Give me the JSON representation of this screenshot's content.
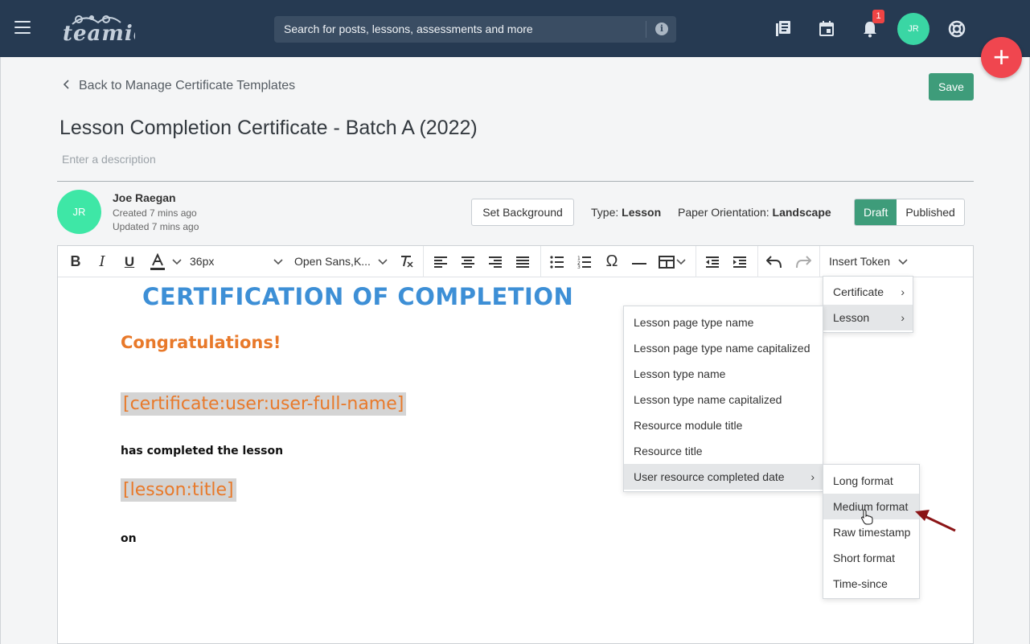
{
  "topbar": {
    "search_placeholder": "Search for posts, lessons, assessments and more",
    "notification_count": "1",
    "avatar_initials": "JR",
    "brand_color": "#263a52",
    "fab_label": "+"
  },
  "page": {
    "back_label": "Back to Manage Certificate Templates",
    "save_label": "Save",
    "title": "Lesson Completion Certificate - Batch A (2022)",
    "description_placeholder": "Enter a description",
    "author": {
      "initials": "JR",
      "name": "Joe Raegan",
      "created": "Created 7 mins ago",
      "updated": "Updated 7 mins ago"
    },
    "set_background_label": "Set Background",
    "type_label": "Type:",
    "type_value": "Lesson",
    "orientation_label": "Paper Orientation:",
    "orientation_value": "Landscape",
    "status_options": [
      "Draft",
      "Published"
    ],
    "status_selected": "Draft"
  },
  "toolbar": {
    "font_size": "36px",
    "font_family": "Open Sans,K...",
    "insert_token_label": "Insert Token",
    "icons": [
      "bold-icon",
      "italic-icon",
      "underline-icon",
      "text-color-icon",
      "clear-format-icon",
      "align-left-icon",
      "align-center-icon",
      "align-right-icon",
      "align-justify-icon",
      "bullet-list-icon",
      "numbered-list-icon",
      "special-char-icon",
      "horizontal-rule-icon",
      "table-icon",
      "outdent-icon",
      "indent-icon",
      "undo-icon",
      "redo-icon"
    ]
  },
  "content": {
    "cert_title": "CERTIFICATION OF COMPLETION",
    "congrats": "Congratulations!",
    "user_token": "[certificate:user:user-full-name]",
    "completed_text": "has completed the lesson",
    "lesson_token": "[lesson:title]",
    "on_text": "on"
  },
  "menus": {
    "insert_token": [
      "Certificate",
      "Lesson"
    ],
    "lesson": [
      "Lesson page type name",
      "Lesson page type name capitalized",
      "Lesson type name",
      "Lesson type name capitalized",
      "Resource module title",
      "Resource title",
      "User resource completed date"
    ],
    "date_formats": [
      "Long format",
      "Medium format",
      "Raw timestamp",
      "Short format",
      "Time-since"
    ]
  }
}
